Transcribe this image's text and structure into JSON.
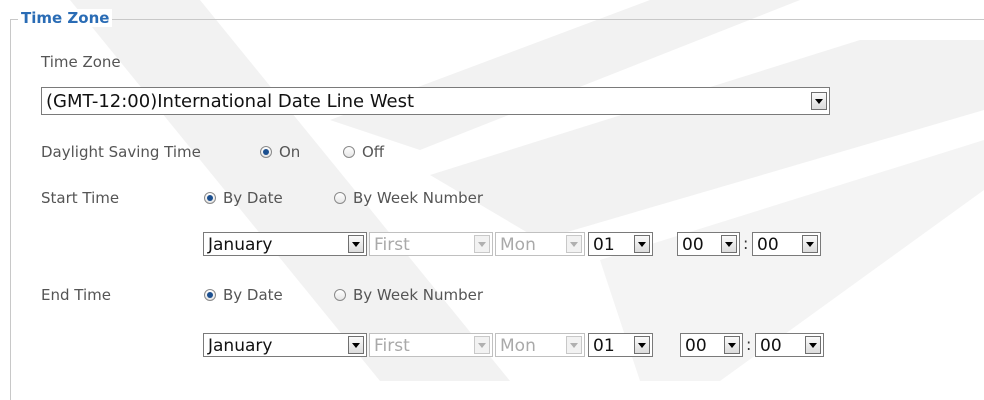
{
  "section": {
    "legend": "Time Zone"
  },
  "timezone": {
    "label": "Time Zone",
    "value": "(GMT-12:00)International Date Line West"
  },
  "dst": {
    "label": "Daylight Saving Time",
    "on_label": "On",
    "off_label": "Off",
    "selected": "On"
  },
  "start": {
    "label": "Start Time",
    "by_date": "By Date",
    "by_week": "By Week Number",
    "selected": "By Date",
    "month": "January",
    "week": "First",
    "weekday": "Mon",
    "day": "01",
    "hour": "00",
    "minute": "00"
  },
  "end": {
    "label": "End Time",
    "by_date": "By Date",
    "by_week": "By Week Number",
    "selected": "By Date",
    "month": "January",
    "week": "First",
    "weekday": "Mon",
    "day": "01",
    "hour": "00",
    "minute": "00"
  },
  "colors": {
    "legend": "#2a6cb5",
    "label": "#555555",
    "radio_dot": "#1b4f8f",
    "watermark": "#f0f0f0"
  }
}
